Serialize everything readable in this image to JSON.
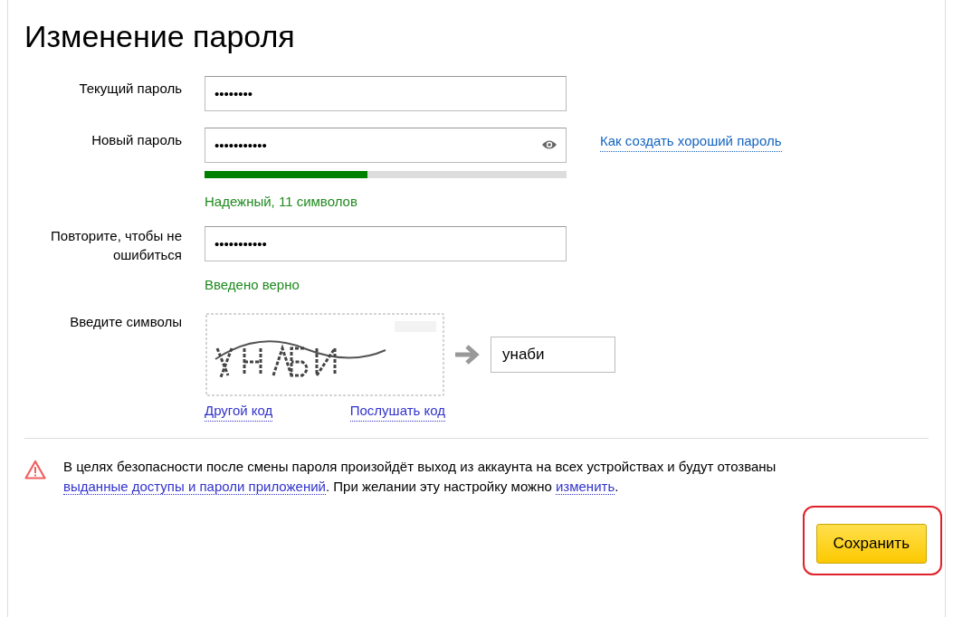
{
  "title": "Изменение пароля",
  "fields": [
    {
      "kind": "password",
      "label": "Текущий пароль",
      "value": "••••••••"
    },
    {
      "kind": "new_password",
      "label": "Новый пароль",
      "value": "•••••••••••",
      "link": "Как создать хороший пароль",
      "strength": {
        "level": 0.45,
        "text": "Надежный, 11 символов"
      }
    },
    {
      "kind": "password",
      "label": "Повторите, чтобы не ошибиться",
      "value": "•••••••••••",
      "hint": "Введено верно"
    },
    {
      "kind": "captcha",
      "label": "Введите символы",
      "value": "унаби",
      "links": [
        "Другой код",
        "Послушать код"
      ]
    }
  ],
  "notice": [
    {
      "kind": "text",
      "text": "В целях безопасности после смены пароля произойдёт выход из аккаунта на всех устройствах и будут отозваны "
    },
    {
      "kind": "link",
      "text": "выданные доступы и пароли приложений"
    },
    {
      "kind": "text",
      "text": ". При желании эту настройку можно "
    },
    {
      "kind": "link",
      "text": "изменить"
    },
    {
      "kind": "text",
      "text": "."
    }
  ],
  "save_button": {
    "label": "Сохранить",
    "highlighted": true
  }
}
